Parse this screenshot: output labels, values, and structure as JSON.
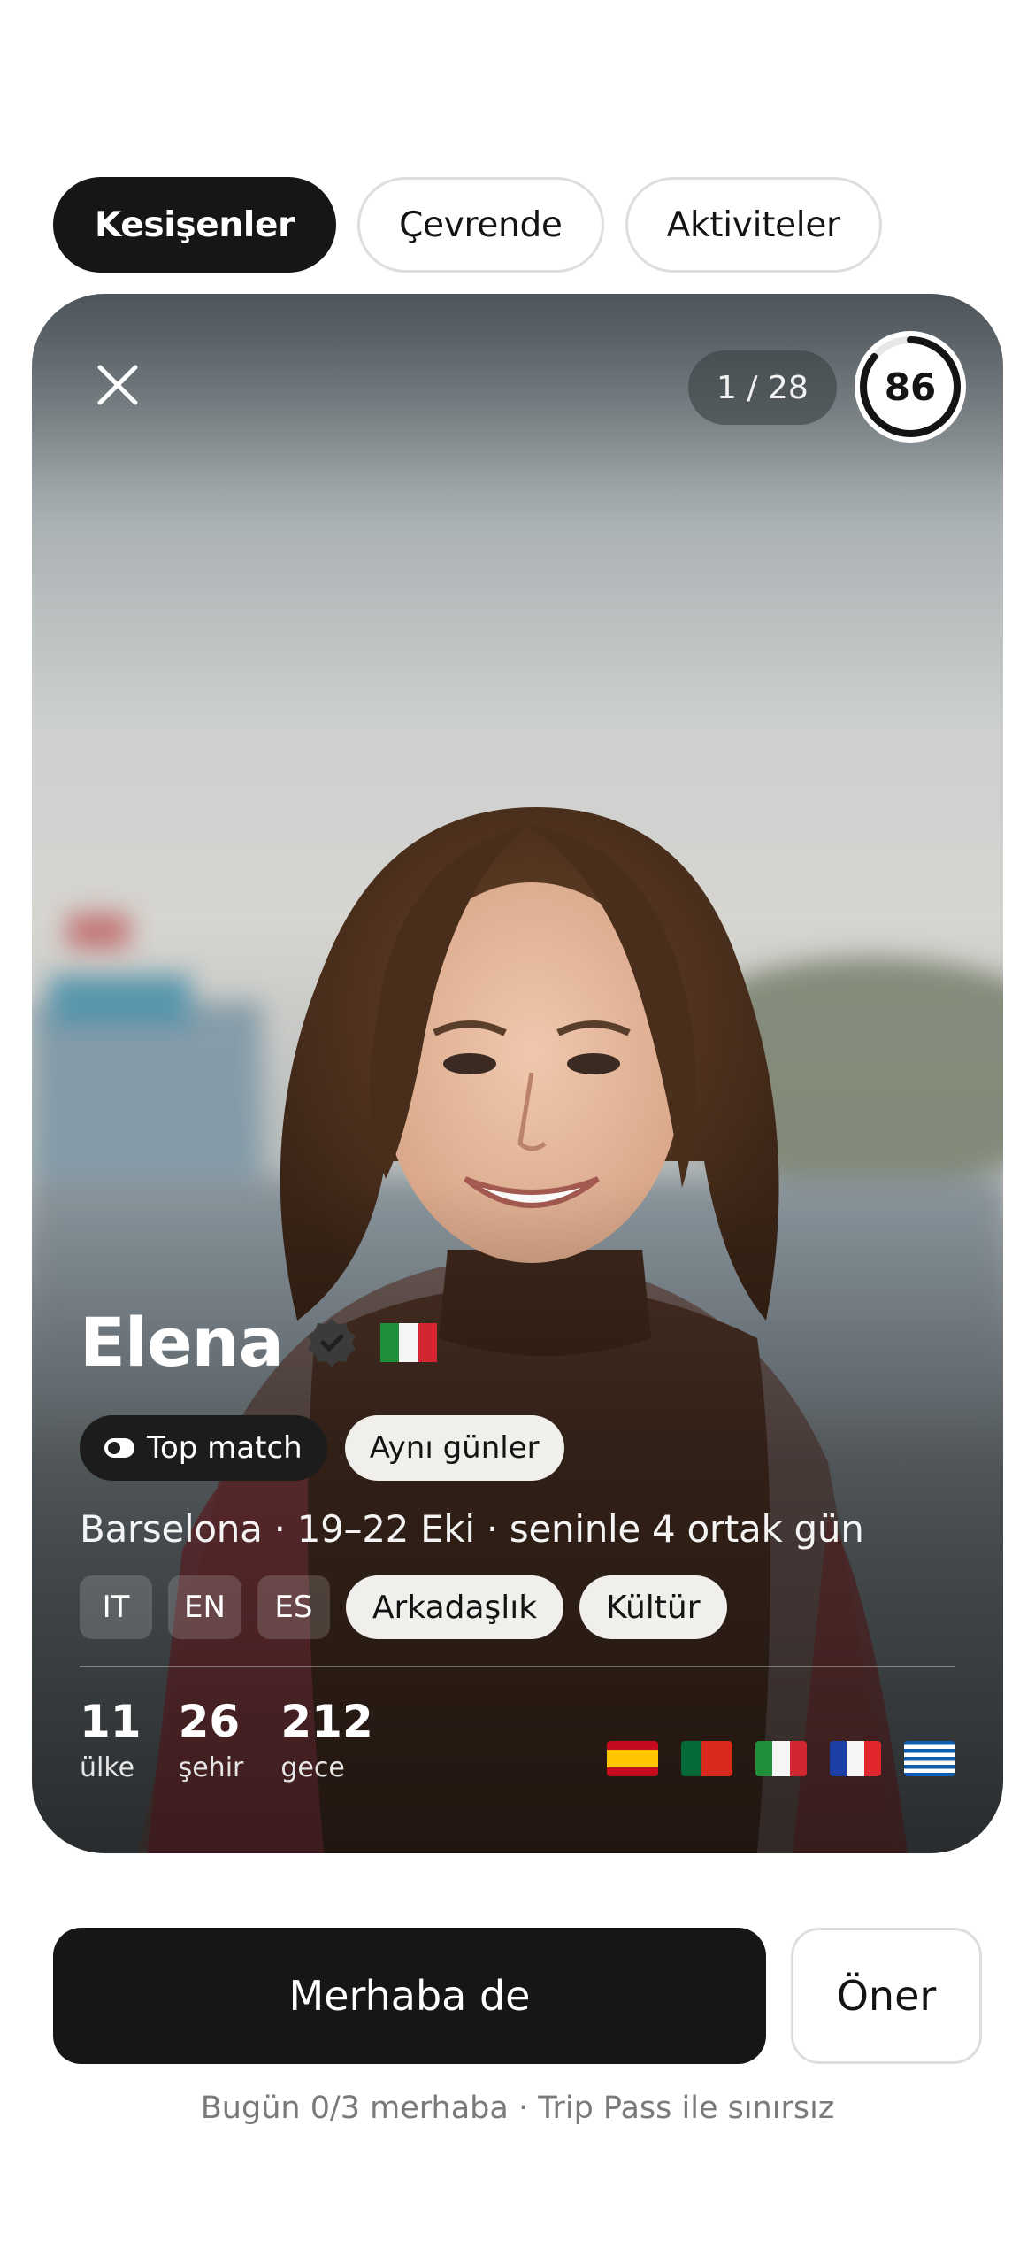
{
  "tabs": [
    {
      "label": "Kesişenler",
      "active": true
    },
    {
      "label": "Çevrende",
      "active": false
    },
    {
      "label": "Aktiviteler",
      "active": false
    }
  ],
  "card": {
    "counter": "1 / 28",
    "score": "86",
    "score_fraction": 0.86,
    "name": "Elena",
    "nationality_flag_icon": "flag-italy-icon",
    "badges": {
      "top_match": "Top match",
      "same_days": "Aynı günler"
    },
    "meta": "Barselona · 19–22 Eki · seninle 4 ortak gün",
    "languages": [
      "IT",
      "EN",
      "ES"
    ],
    "interests": [
      "Arkadaşlık",
      "Kültür"
    ],
    "stats": [
      {
        "value": "11",
        "label": "ülke"
      },
      {
        "value": "26",
        "label": "şehir"
      },
      {
        "value": "212",
        "label": "gece"
      }
    ],
    "visited_flags": [
      "flag-spain-icon",
      "flag-portugal-icon",
      "flag-italy-icon",
      "flag-france-icon",
      "flag-greece-icon"
    ]
  },
  "actions": {
    "primary": "Merhaba de",
    "secondary": "Öner",
    "footnote": "Bugün 0/3 merhaba · Trip Pass ile sınırsız"
  },
  "colors": {
    "primary_bg": "#161616",
    "chip_light": "#f1efec"
  }
}
